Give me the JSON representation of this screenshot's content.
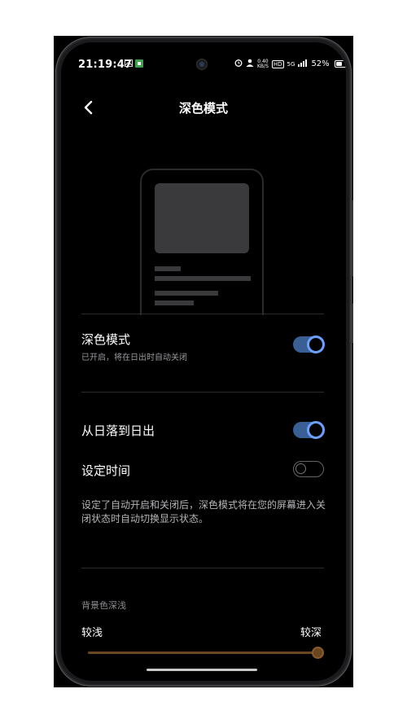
{
  "status_bar": {
    "time": "21:19:47",
    "net_speed_value": "0.40",
    "net_speed_unit": "KB/S",
    "hd_label": "HD",
    "network_label": "5G",
    "battery_text": "52%",
    "battery_level": 0.52
  },
  "header": {
    "title": "深色模式"
  },
  "dark_mode": {
    "title": "深色模式",
    "subtitle": "已开启，将在日出时自动关闭",
    "enabled": true
  },
  "schedule": {
    "sunset_label": "从日落到日出",
    "sunset_enabled": true,
    "custom_time_label": "设定时间",
    "custom_time_enabled": false,
    "note": "设定了自动开启和关闭后，深色模式将在您的屏幕进入关闭状态时自动切换显示状态。"
  },
  "background_depth": {
    "section_label": "背景色深浅",
    "min_label": "较浅",
    "max_label": "较深",
    "value": 1.0
  },
  "colors": {
    "accent_blue": "#6aa0ff",
    "toggle_track_on": "#3a5f95",
    "slider_brown": "#6b4520"
  }
}
